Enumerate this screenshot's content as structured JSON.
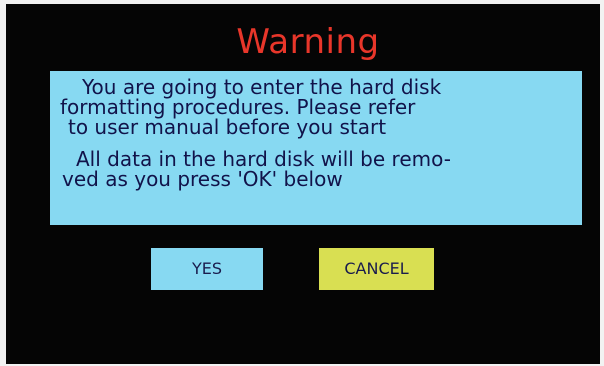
{
  "dialog": {
    "title": "Warning",
    "message_lines": [
      "You are going to enter the hard disk",
      "formatting procedures. Please refer",
      "to user manual before you start",
      "All data in the hard disk will be remo-",
      "ved as you press 'OK' below"
    ],
    "buttons": {
      "yes_label": "YES",
      "cancel_label": "CANCEL"
    }
  },
  "colors": {
    "background": "#050505",
    "title": "#e8362a",
    "message_box": "#87d9f2",
    "yes_button": "#87d9f2",
    "cancel_button_focused": "#d9df52",
    "text": "#11134a"
  }
}
